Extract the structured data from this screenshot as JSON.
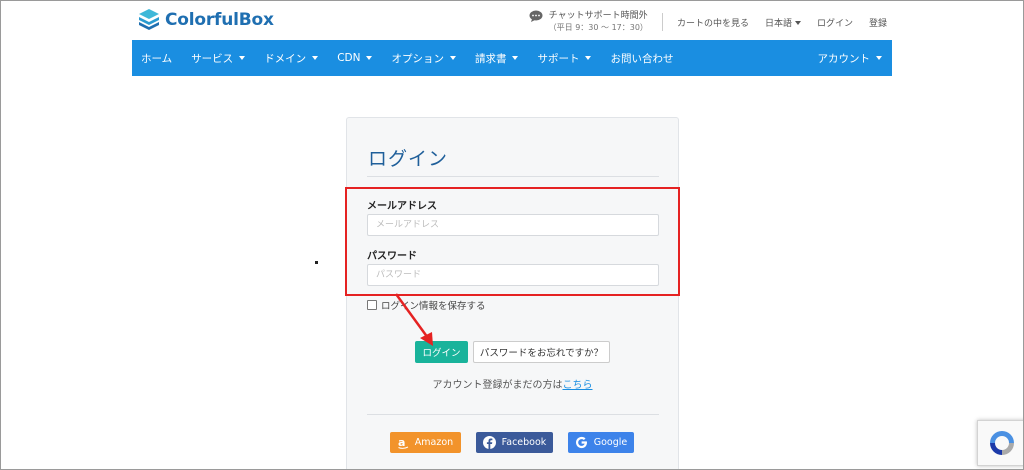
{
  "header": {
    "logo_text": "ColorfulBox",
    "chat_title": "チャットサポート時間外",
    "chat_hours": "（平日 9：30 〜 17：30）",
    "cart_link": "カートの中を見る",
    "language": "日本語",
    "login_link": "ログイン",
    "register_link": "登録"
  },
  "nav": {
    "items": [
      {
        "label": "ホーム",
        "dropdown": false
      },
      {
        "label": "サービス",
        "dropdown": true
      },
      {
        "label": "ドメイン",
        "dropdown": true
      },
      {
        "label": "CDN",
        "dropdown": true
      },
      {
        "label": "オプション",
        "dropdown": true
      },
      {
        "label": "請求書",
        "dropdown": true
      },
      {
        "label": "サポート",
        "dropdown": true
      },
      {
        "label": "お問い合わせ",
        "dropdown": false
      }
    ],
    "account": "アカウント"
  },
  "login": {
    "title": "ログイン",
    "email_label": "メールアドレス",
    "email_placeholder": "メールアドレス",
    "email_value": "",
    "password_label": "パスワード",
    "password_placeholder": "パスワード",
    "password_value": "",
    "remember_label": "ログイン情報を保存する",
    "remember_checked": false,
    "submit_label": "ログイン",
    "forgot_label": "パスワードをお忘れですか？",
    "register_text": "アカウント登録がまだの方は",
    "register_link": "こちら"
  },
  "social": {
    "amazon": "Amazon",
    "facebook": "Facebook",
    "google": "Google"
  },
  "colors": {
    "brand": "#1f6fb1",
    "nav_bg": "#1a8ee1",
    "login_button": "#19b39b",
    "highlight": "#e52222",
    "amazon": "#f2932b",
    "facebook": "#3b5a9a",
    "google": "#3d83ea"
  }
}
